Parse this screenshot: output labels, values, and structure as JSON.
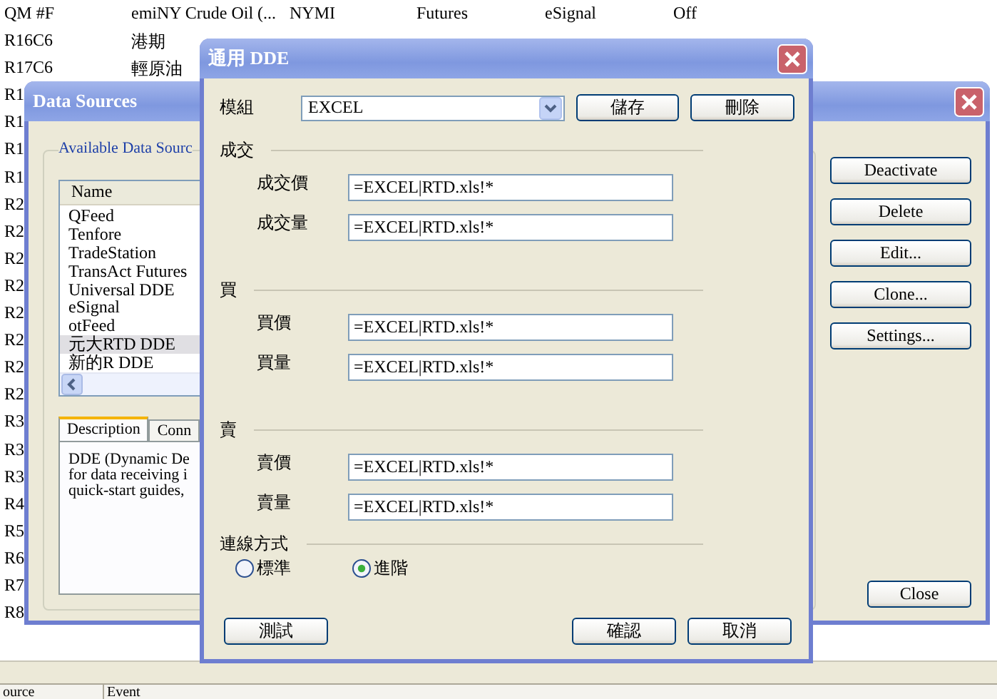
{
  "background_table": {
    "rows": [
      {
        "cells": [
          "QM #F",
          "emiNY Crude Oil (...",
          "NYMI",
          "Futures",
          "eSignal",
          "Off"
        ]
      },
      {
        "cells": [
          "R16C6",
          "港期"
        ]
      },
      {
        "cells": [
          "R17C6",
          "輕原油"
        ]
      },
      {
        "cells": [
          "R1"
        ]
      },
      {
        "cells": [
          "R1"
        ]
      },
      {
        "cells": [
          "R1"
        ]
      },
      {
        "cells": [
          "R1"
        ]
      },
      {
        "cells": [
          "R2"
        ]
      },
      {
        "cells": [
          "R2"
        ]
      },
      {
        "cells": [
          "R2"
        ]
      },
      {
        "cells": [
          "R2"
        ]
      },
      {
        "cells": [
          "R2"
        ]
      },
      {
        "cells": [
          "R2"
        ]
      },
      {
        "cells": [
          "R2"
        ]
      },
      {
        "cells": [
          "R2"
        ]
      },
      {
        "cells": [
          "R3"
        ]
      },
      {
        "cells": [
          "R3"
        ]
      },
      {
        "cells": [
          "R3"
        ]
      },
      {
        "cells": [
          "R4"
        ]
      },
      {
        "cells": [
          "R5"
        ]
      },
      {
        "cells": [
          "R6"
        ]
      },
      {
        "cells": [
          "R7"
        ]
      },
      {
        "cells": [
          "R8"
        ]
      }
    ]
  },
  "log_panel": {
    "columns": [
      "ource",
      "Event"
    ]
  },
  "data_sources_window": {
    "title": "Data Sources",
    "group_label": "Available Data Sourc",
    "list": {
      "columns": [
        "Name"
      ],
      "items": [
        {
          "label": "QFeed",
          "selected": false
        },
        {
          "label": "Tenfore",
          "selected": false
        },
        {
          "label": "TradeStation",
          "selected": false
        },
        {
          "label": "TransAct Futures",
          "selected": false
        },
        {
          "label": "Universal DDE",
          "selected": false
        },
        {
          "label": "eSignal",
          "selected": false
        },
        {
          "label": "otFeed",
          "selected": false
        },
        {
          "label": "元大RTD DDE",
          "selected": true
        },
        {
          "label": "新的R DDE",
          "selected": false
        }
      ]
    },
    "tabs": [
      {
        "label": "Description",
        "selected": true
      },
      {
        "label": "Conn",
        "selected": false
      }
    ],
    "description_lines": [
      "DDE (Dynamic De",
      "for data receiving i",
      "quick-start guides,"
    ],
    "buttons": [
      "Deactivate",
      "Delete",
      "Edit...",
      "Clone...",
      "Settings..."
    ],
    "close_button": "Close"
  },
  "dde_dialog": {
    "title": "通用 DDE",
    "template_label": "模組",
    "template_value": "EXCEL",
    "template_buttons": [
      "儲存",
      "刪除"
    ],
    "sections": [
      {
        "title": "成交",
        "fields": [
          {
            "label": "成交價",
            "value": "=EXCEL|RTD.xls!*"
          },
          {
            "label": "成交量",
            "value": "=EXCEL|RTD.xls!*"
          }
        ]
      },
      {
        "title": "買",
        "fields": [
          {
            "label": "買價",
            "value": "=EXCEL|RTD.xls!*"
          },
          {
            "label": "買量",
            "value": "=EXCEL|RTD.xls!*"
          }
        ]
      },
      {
        "title": "賣",
        "fields": [
          {
            "label": "賣價",
            "value": "=EXCEL|RTD.xls!*"
          },
          {
            "label": "賣量",
            "value": "=EXCEL|RTD.xls!*"
          }
        ]
      }
    ],
    "connection_label": "連線方式",
    "connection_options": [
      {
        "label": "標準",
        "selected": false
      },
      {
        "label": "進階",
        "selected": true
      }
    ],
    "test_button": "測試",
    "ok_button": "確認",
    "cancel_button": "取消"
  }
}
